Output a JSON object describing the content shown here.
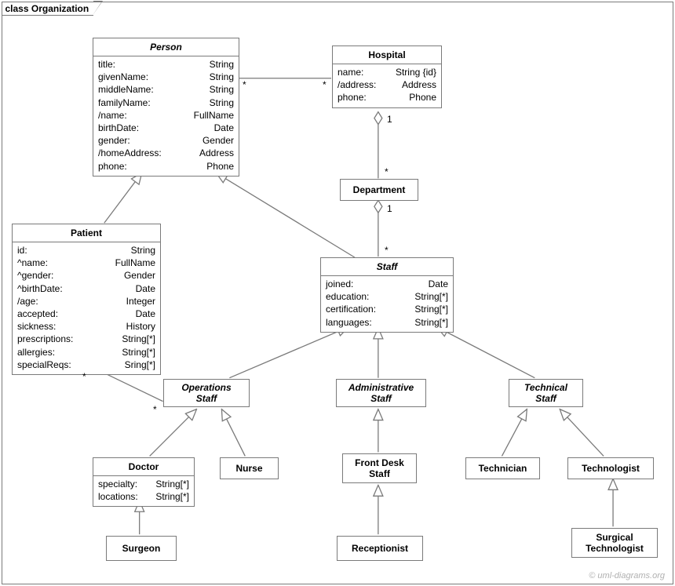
{
  "frame_label": "class Organization",
  "copyright": "© uml-diagrams.org",
  "classes": {
    "person": {
      "name": "Person",
      "attrs": [
        [
          "title:",
          "String"
        ],
        [
          "givenName:",
          "String"
        ],
        [
          "middleName:",
          "String"
        ],
        [
          "familyName:",
          "String"
        ],
        [
          "/name:",
          "FullName"
        ],
        [
          "birthDate:",
          "Date"
        ],
        [
          "gender:",
          "Gender"
        ],
        [
          "/homeAddress:",
          "Address"
        ],
        [
          "phone:",
          "Phone"
        ]
      ]
    },
    "hospital": {
      "name": "Hospital",
      "attrs": [
        [
          "name:",
          "String {id}"
        ],
        [
          "/address:",
          "Address"
        ],
        [
          "phone:",
          "Phone"
        ]
      ]
    },
    "department": {
      "name": "Department"
    },
    "patient": {
      "name": "Patient",
      "attrs": [
        [
          "id:",
          "String"
        ],
        [
          "^name:",
          "FullName"
        ],
        [
          "^gender:",
          "Gender"
        ],
        [
          "^birthDate:",
          "Date"
        ],
        [
          "/age:",
          "Integer"
        ],
        [
          "accepted:",
          "Date"
        ],
        [
          "sickness:",
          "History"
        ],
        [
          "prescriptions:",
          "String[*]"
        ],
        [
          "allergies:",
          "String[*]"
        ],
        [
          "specialReqs:",
          "Sring[*]"
        ]
      ]
    },
    "staff": {
      "name": "Staff",
      "attrs": [
        [
          "joined:",
          "Date"
        ],
        [
          "education:",
          "String[*]"
        ],
        [
          "certification:",
          "String[*]"
        ],
        [
          "languages:",
          "String[*]"
        ]
      ]
    },
    "opsStaff": {
      "name": "Operations\nStaff"
    },
    "adminStaff": {
      "name": "Administrative\nStaff"
    },
    "techStaff": {
      "name": "Technical\nStaff"
    },
    "doctor": {
      "name": "Doctor",
      "attrs": [
        [
          "specialty:",
          "String[*]"
        ],
        [
          "locations:",
          "String[*]"
        ]
      ]
    },
    "nurse": {
      "name": "Nurse"
    },
    "frontDesk": {
      "name": "Front Desk\nStaff"
    },
    "technician": {
      "name": "Technician"
    },
    "technologist": {
      "name": "Technologist"
    },
    "surgeon": {
      "name": "Surgeon"
    },
    "receptionist": {
      "name": "Receptionist"
    },
    "surgTech": {
      "name": "Surgical\nTechnologist"
    }
  },
  "mults": {
    "person_hosp_l": "*",
    "person_hosp_r": "*",
    "hosp_dept_t": "1",
    "hosp_dept_b": "*",
    "dept_staff_t": "1",
    "dept_staff_b": "*",
    "pat_ops_l": "*",
    "pat_ops_r": "*"
  }
}
